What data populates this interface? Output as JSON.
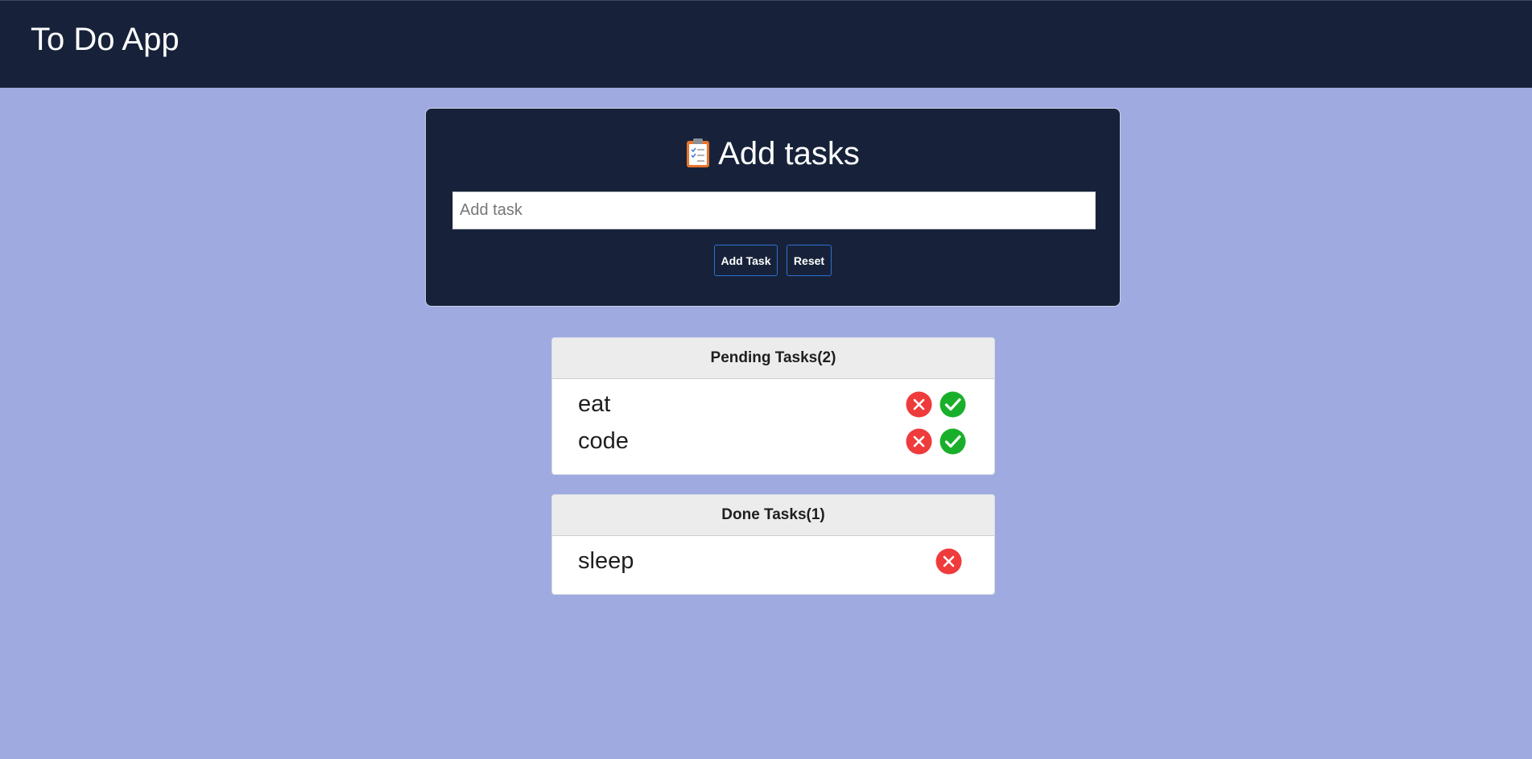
{
  "app": {
    "title": "To Do App"
  },
  "add_card": {
    "heading": "Add tasks",
    "icon": "clipboard-icon",
    "input_placeholder": "Add task",
    "input_value": "",
    "add_button_label": "Add Task",
    "reset_button_label": "Reset"
  },
  "pending": {
    "header": "Pending Tasks(2)",
    "tasks": [
      {
        "label": "eat",
        "actions": [
          "delete-icon",
          "check-icon"
        ]
      },
      {
        "label": "code",
        "actions": [
          "delete-icon",
          "check-icon"
        ]
      }
    ]
  },
  "done": {
    "header": "Done Tasks(1)",
    "tasks": [
      {
        "label": "sleep",
        "actions": [
          "delete-icon"
        ]
      }
    ]
  },
  "colors": {
    "navbar": "#17223a",
    "background": "#9eaae0",
    "delete": "#ef3b3b",
    "check": "#1aaf2a"
  }
}
